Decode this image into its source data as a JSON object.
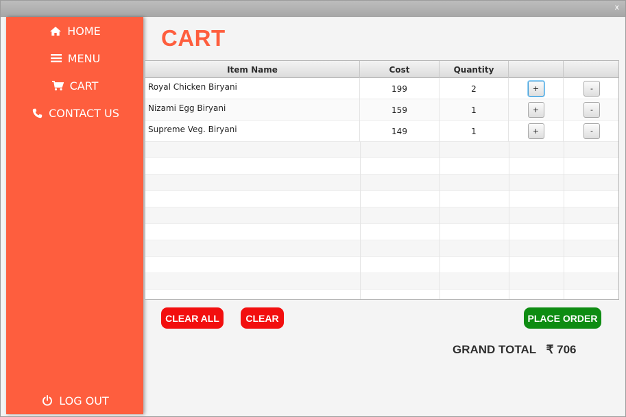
{
  "window": {
    "close_label": "x"
  },
  "sidebar": {
    "items": [
      {
        "label": "HOME",
        "icon": "home-icon"
      },
      {
        "label": "MENU",
        "icon": "hamburger-menu-icon"
      },
      {
        "label": "CART",
        "icon": "cart-icon"
      },
      {
        "label": "CONTACT US",
        "icon": "phone-icon"
      }
    ],
    "logout": {
      "label": "LOG OUT",
      "icon": "power-icon"
    }
  },
  "page": {
    "title": "CART"
  },
  "table": {
    "columns": [
      "Item Name",
      "Cost",
      "Quantity",
      "",
      ""
    ],
    "rows": [
      {
        "name": "Royal Chicken Biryani",
        "cost": "199",
        "qty": "2",
        "plus": "+",
        "minus": "-"
      },
      {
        "name": "Nizami Egg Biryani",
        "cost": "159",
        "qty": "1",
        "plus": "+",
        "minus": "-"
      },
      {
        "name": "Supreme Veg. Biryani",
        "cost": "149",
        "qty": "1",
        "plus": "+",
        "minus": "-"
      }
    ]
  },
  "actions": {
    "clear_all": "CLEAR ALL",
    "clear": "CLEAR",
    "place_order": "PLACE ORDER"
  },
  "total": {
    "label": "GRAND TOTAL",
    "amount": "₹ 706"
  },
  "colors": {
    "sidebar": "#fe5e3e",
    "title": "#fe5e3e",
    "danger": "#f20f0f",
    "success": "#0e8c12"
  }
}
